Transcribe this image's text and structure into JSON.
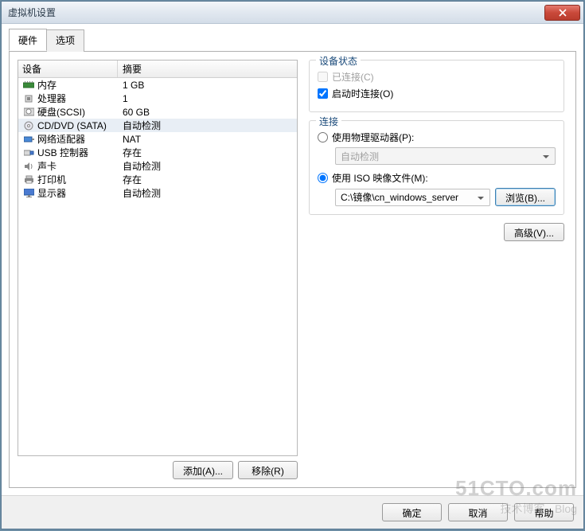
{
  "window": {
    "title": "虚拟机设置"
  },
  "tabs": {
    "hardware": "硬件",
    "options": "选项"
  },
  "hw_header": {
    "device": "设备",
    "summary": "摘要"
  },
  "hw_rows": [
    {
      "name": "内存",
      "val": "1 GB",
      "icon": "memory"
    },
    {
      "name": "处理器",
      "val": "1",
      "icon": "cpu"
    },
    {
      "name": "硬盘(SCSI)",
      "val": "60 GB",
      "icon": "hdd"
    },
    {
      "name": "CD/DVD (SATA)",
      "val": "自动检测",
      "icon": "cd"
    },
    {
      "name": "网络适配器",
      "val": "NAT",
      "icon": "net"
    },
    {
      "name": "USB 控制器",
      "val": "存在",
      "icon": "usb"
    },
    {
      "name": "声卡",
      "val": "自动检测",
      "icon": "sound"
    },
    {
      "name": "打印机",
      "val": "存在",
      "icon": "printer"
    },
    {
      "name": "显示器",
      "val": "自动检测",
      "icon": "display"
    }
  ],
  "buttons": {
    "add": "添加(A)...",
    "remove": "移除(R)",
    "browse": "浏览(B)...",
    "advanced": "高级(V)...",
    "ok": "确定",
    "cancel": "取消",
    "help": "帮助"
  },
  "groups": {
    "device_status": "设备状态",
    "connection": "连接"
  },
  "status": {
    "connected": "已连接(C)",
    "connect_on_start": "启动时连接(O)"
  },
  "connection": {
    "physical": "使用物理驱动器(P):",
    "physical_value": "自动检测",
    "iso": "使用 ISO 映像文件(M):",
    "iso_path": "C:\\镜像\\cn_windows_server"
  },
  "watermark": {
    "big": "51CTO.com",
    "small": "技术博客 · Blog"
  }
}
